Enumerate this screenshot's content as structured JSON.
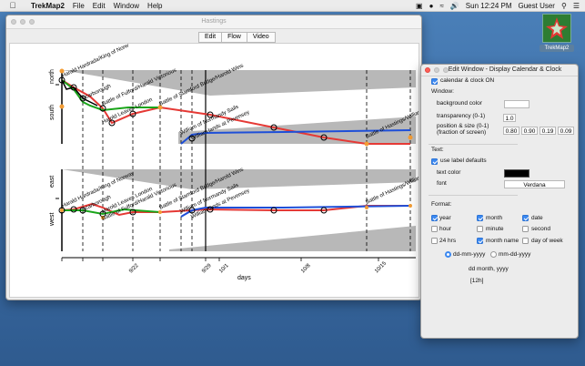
{
  "menubar": {
    "app_name": "TrekMap2",
    "menus": [
      "File",
      "Edit",
      "Window",
      "Help"
    ],
    "time": "Sun 12:24 PM",
    "user": "Guest User"
  },
  "desktop_icon": {
    "label": "TrekMap2"
  },
  "main_window": {
    "title": "Hastings",
    "tabs": [
      "Edit",
      "Flow",
      "Video"
    ],
    "axis": {
      "north_label": "north",
      "south_label": "south",
      "east_label": "east",
      "west_label": "west",
      "x_label": "days",
      "x_ticks": [
        "9/22",
        "9/29",
        "10/1",
        "10/8",
        "10/15"
      ]
    },
    "event_labels_top": [
      "Harald Hardrada/King of Norw",
      "Scarborough",
      "Battle of Fulford/Harald Victorious",
      "Battle of Stamford Bridge/Harold Wins",
      "Harold Leaves London",
      "William of Normandy Sails",
      "William lands at Pevensey",
      "Battle of Hastings/William"
    ],
    "event_labels_bottom": [
      "Harald Hardrada/King of Norway",
      "Scarborough",
      "Harold Leaves London",
      "Battle of Fulford/Harald Victorious",
      "Battle of Stamford Bridge/Harold Wins",
      "William of Normandy Sails",
      "William lands at Pevensey",
      "Battle of Hastings/William"
    ]
  },
  "prefs": {
    "title": "Edit Window - Display Calendar & Clock",
    "calendar_clock_label": "calendar & clock ON",
    "window_header": "Window:",
    "background_color_label": "background color",
    "transparency_label": "transparency (0-1)",
    "transparency_value": "1.0",
    "position_label_1": "position & size (0-1)",
    "position_label_2": "(fraction of screen)",
    "position_values": [
      "0.80",
      "0.90",
      "0.19",
      "0.09"
    ],
    "text_header": "Text:",
    "use_label_defaults": "use label defaults",
    "text_color_label": "text color",
    "font_label": "font",
    "font_value": "Verdana",
    "format_header": "Format:",
    "options": [
      {
        "label": "year",
        "checked": true
      },
      {
        "label": "month",
        "checked": true
      },
      {
        "label": "date",
        "checked": true
      },
      {
        "label": "hour",
        "checked": false
      },
      {
        "label": "minute",
        "checked": false
      },
      {
        "label": "second",
        "checked": false
      },
      {
        "label": "24 hrs",
        "checked": false
      },
      {
        "label": "month name",
        "checked": true
      },
      {
        "label": "day of week",
        "checked": false
      }
    ],
    "date_format_1": "dd-mm-yyyy",
    "date_format_2": "mm-dd-yyyy",
    "sample_date": "dd month, yyyy",
    "sample_time": "[12h]",
    "colors": {
      "background": "#ffffff",
      "text": "#000000"
    }
  }
}
